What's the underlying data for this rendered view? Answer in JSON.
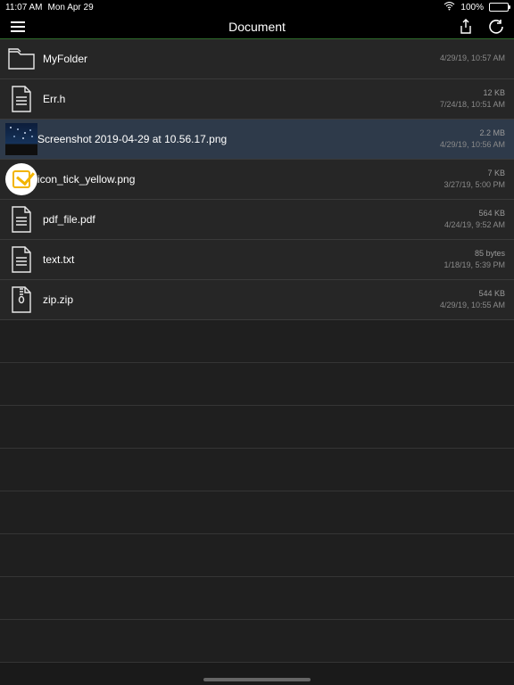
{
  "statusbar": {
    "time": "11:07 AM",
    "date": "Mon Apr 29",
    "battery_pct": "100%"
  },
  "navbar": {
    "title": "Document"
  },
  "files": [
    {
      "name": "MyFolder",
      "size": "",
      "date": "4/29/19, 10:57 AM",
      "type": "folder",
      "selected": false
    },
    {
      "name": "Err.h",
      "size": "12 KB",
      "date": "7/24/18, 10:51 AM",
      "type": "file",
      "selected": false
    },
    {
      "name": "Screenshot 2019-04-29 at 10.56.17.png",
      "size": "2.2 MB",
      "date": "4/29/19, 10:56 AM",
      "type": "image",
      "selected": true
    },
    {
      "name": "icon_tick_yellow.png",
      "size": "7 KB",
      "date": "3/27/19, 5:00 PM",
      "type": "tick",
      "selected": false
    },
    {
      "name": "pdf_file.pdf",
      "size": "564 KB",
      "date": "4/24/19, 9:52 AM",
      "type": "file",
      "selected": false
    },
    {
      "name": "text.txt",
      "size": "85 bytes",
      "date": "1/18/19, 5:39 PM",
      "type": "file",
      "selected": false
    },
    {
      "name": "zip.zip",
      "size": "544 KB",
      "date": "4/29/19, 10:55 AM",
      "type": "zip",
      "selected": false
    }
  ]
}
